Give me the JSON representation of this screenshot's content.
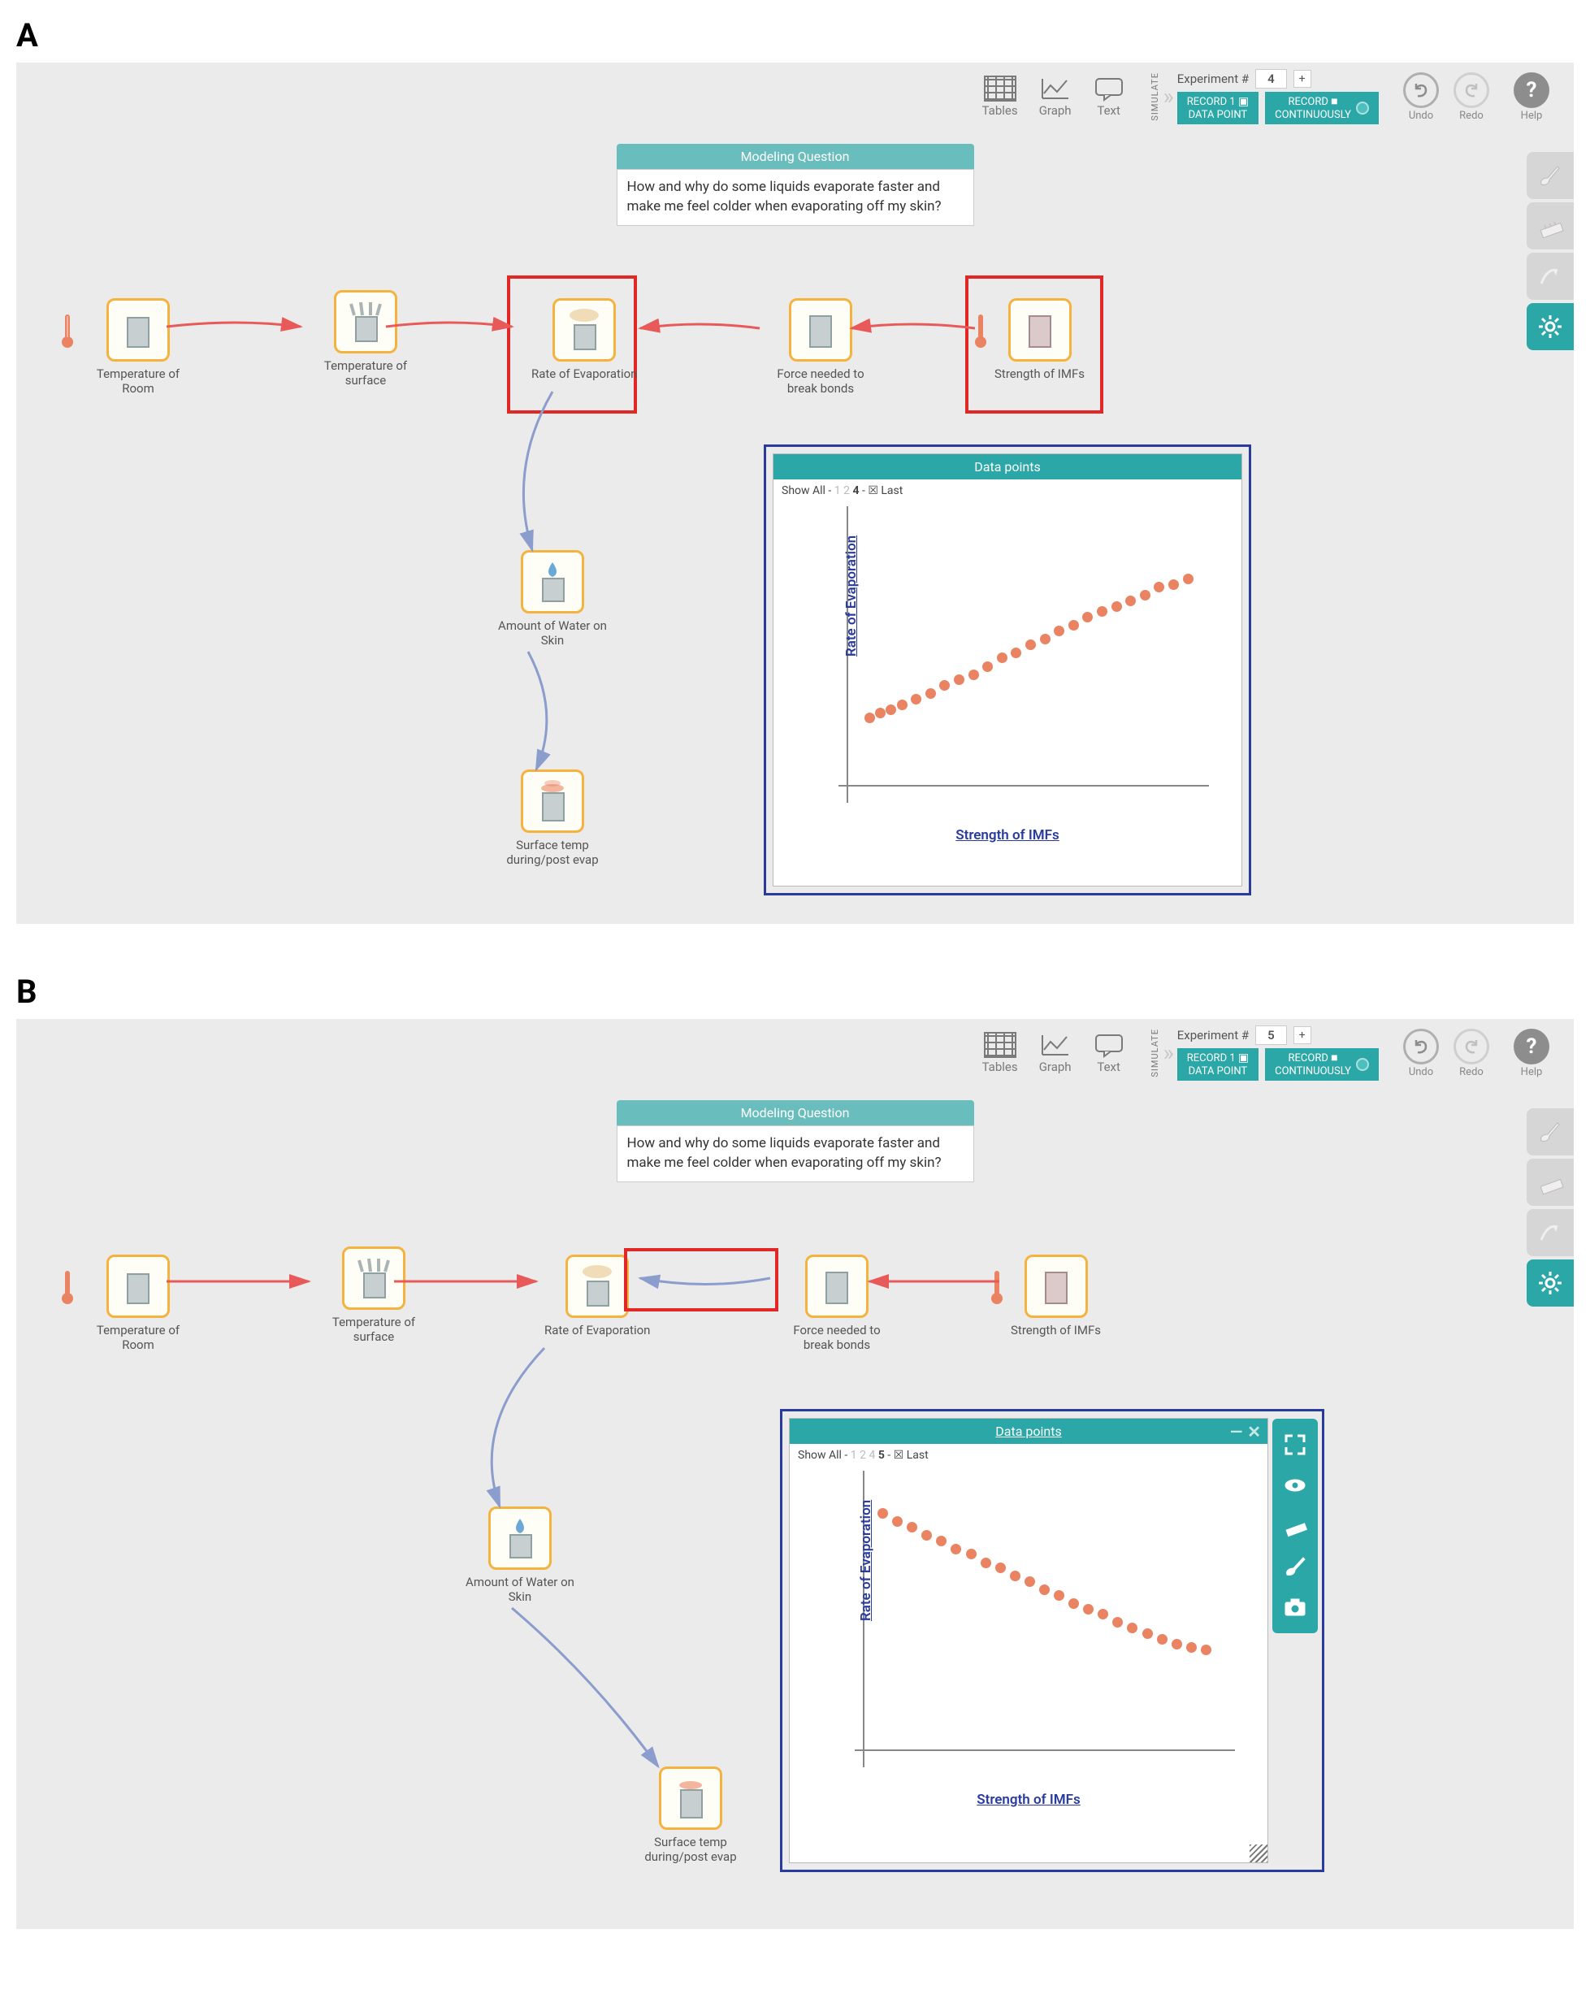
{
  "panels": {
    "A": {
      "label": "A",
      "experiment_num": "4"
    },
    "B": {
      "label": "B",
      "experiment_num": "5"
    }
  },
  "toolbar": {
    "tables": "Tables",
    "graph": "Graph",
    "text": "Text",
    "simulate": "SIMULATE",
    "experiment_label": "Experiment #",
    "plus": "+",
    "record1_l1": "RECORD 1",
    "record1_l2": "DATA POINT",
    "record_cont_l1": "RECORD",
    "record_cont_l2": "CONTINUOUSLY",
    "undo": "Undo",
    "redo": "Redo",
    "help": "Help",
    "help_q": "?"
  },
  "question": {
    "header": "Modeling Question",
    "body": "How and why do some liquids evaporate faster and make me feel colder when evaporating off my skin?"
  },
  "nodes": {
    "temp_room": "Temperature of Room",
    "temp_surface": "Temperature of surface",
    "rate_evap": "Rate of Evaporation",
    "force_bonds": "Force needed to break bonds",
    "strength_imfs": "Strength of IMFs",
    "amount_water": "Amount of Water on Skin",
    "surface_temp": "Surface temp during/post evap"
  },
  "chart": {
    "title": "Data points",
    "filter_prefix": "Show All - ",
    "filter_dim_a": "1 2",
    "filter_bold_a": "4",
    "filter_dim_b": "1 2 4",
    "filter_bold_b": "5",
    "filter_sep": " - ",
    "last": " Last",
    "ylabel": "Rate of Evaporation",
    "xlabel": "Strength of IMFs"
  },
  "chart_data": [
    {
      "panel": "A",
      "type": "scatter",
      "title": "Data points",
      "xlabel": "Strength of IMFs",
      "ylabel": "Rate of Evaporation",
      "xlim": [
        0,
        100
      ],
      "ylim": [
        0,
        100
      ],
      "series": [
        {
          "name": "Experiment 4",
          "x": [
            5,
            8,
            11,
            14,
            18,
            22,
            26,
            30,
            34,
            38,
            42,
            46,
            50,
            54,
            58,
            62,
            66,
            70,
            74,
            78,
            82,
            86,
            90,
            94
          ],
          "y": [
            24,
            26,
            27,
            29,
            31,
            33,
            36,
            38,
            40,
            43,
            46,
            48,
            51,
            53,
            56,
            58,
            61,
            63,
            65,
            67,
            69,
            72,
            73,
            75
          ]
        }
      ]
    },
    {
      "panel": "B",
      "type": "scatter",
      "title": "Data points",
      "xlabel": "Strength of IMFs",
      "ylabel": "Rate of Evaporation",
      "xlim": [
        0,
        100
      ],
      "ylim": [
        0,
        100
      ],
      "series": [
        {
          "name": "Experiment 5",
          "x": [
            4,
            8,
            12,
            16,
            20,
            24,
            28,
            32,
            36,
            40,
            44,
            48,
            52,
            56,
            60,
            64,
            68,
            72,
            76,
            80,
            84,
            88,
            92
          ],
          "y": [
            86,
            83,
            81,
            78,
            76,
            73,
            71,
            68,
            66,
            63,
            61,
            58,
            56,
            53,
            51,
            49,
            46,
            44,
            42,
            40,
            38,
            37,
            36
          ]
        }
      ]
    }
  ]
}
